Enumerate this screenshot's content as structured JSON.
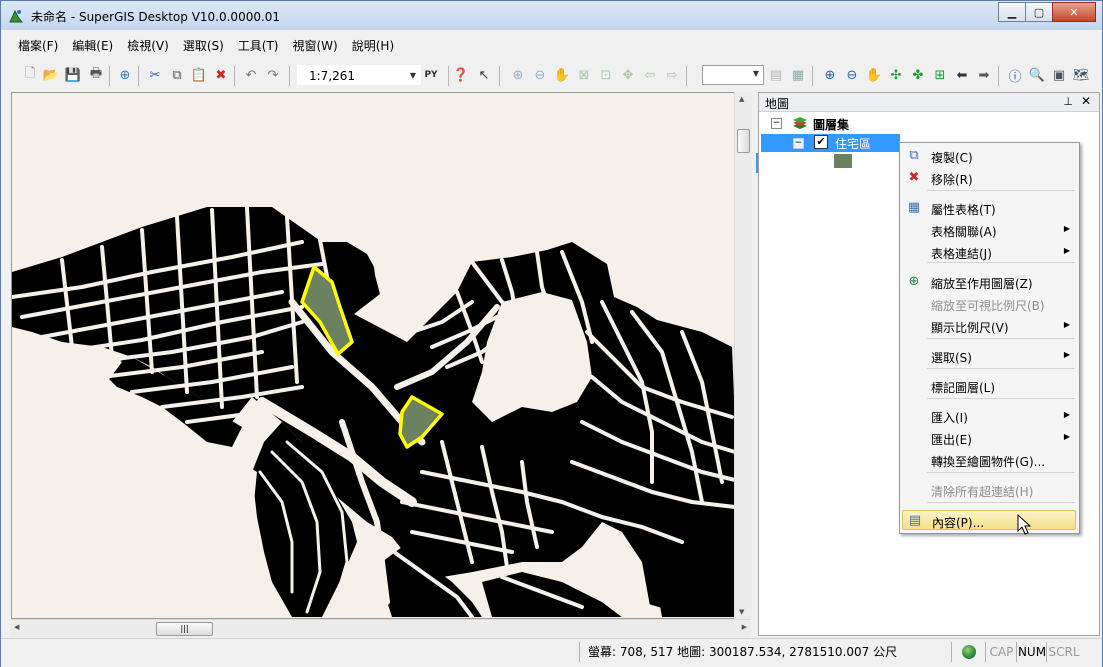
{
  "window": {
    "title": "未命名 - SuperGIS Desktop V10.0.0000.01"
  },
  "menu": [
    "檔案(F)",
    "編輯(E)",
    "檢視(V)",
    "選取(S)",
    "工具(T)",
    "視窗(W)",
    "說明(H)"
  ],
  "toolbar": {
    "scale": "1:7,261"
  },
  "panel": {
    "title": "地圖",
    "root_label": "圖層集",
    "layer_label": "住宅區",
    "layer_color": "#6b8160"
  },
  "map": {
    "fill_color": "#6b8160",
    "background": "#f5f1ea",
    "highlight": "#ffff00"
  },
  "context_menu": [
    {
      "label": "複製(C)",
      "icon": "copy-icon",
      "submenu": false,
      "disabled": false
    },
    {
      "label": "移除(R)",
      "icon": "remove-icon",
      "submenu": false,
      "disabled": false
    },
    {
      "label": "屬性表格(T)",
      "icon": "table-icon",
      "submenu": false,
      "disabled": false
    },
    {
      "label": "表格關聯(A)",
      "icon": "",
      "submenu": true,
      "disabled": false
    },
    {
      "label": "表格連結(J)",
      "icon": "",
      "submenu": true,
      "disabled": false
    },
    {
      "label": "縮放至作用圖層(Z)",
      "icon": "zoom-layer-icon",
      "submenu": false,
      "disabled": false
    },
    {
      "label": "縮放至可視比例尺(B)",
      "icon": "",
      "submenu": false,
      "disabled": true
    },
    {
      "label": "顯示比例尺(V)",
      "icon": "",
      "submenu": true,
      "disabled": false
    },
    {
      "label": "選取(S)",
      "icon": "",
      "submenu": true,
      "disabled": false
    },
    {
      "label": "標記圖層(L)",
      "icon": "",
      "submenu": false,
      "disabled": false
    },
    {
      "label": "匯入(I)",
      "icon": "",
      "submenu": true,
      "disabled": false
    },
    {
      "label": "匯出(E)",
      "icon": "",
      "submenu": true,
      "disabled": false
    },
    {
      "label": "轉換至繪圖物件(G)...",
      "icon": "",
      "submenu": false,
      "disabled": false
    },
    {
      "label": "清除所有超連結(H)",
      "icon": "",
      "submenu": false,
      "disabled": true
    },
    {
      "label": "內容(P)...",
      "icon": "properties-icon",
      "submenu": false,
      "disabled": false
    }
  ],
  "status": {
    "coords": "螢幕: 708, 517  地圖: 300187.534, 2781510.007 公尺",
    "cap": "CAP",
    "num": "NUM",
    "scrl": "SCRL"
  }
}
